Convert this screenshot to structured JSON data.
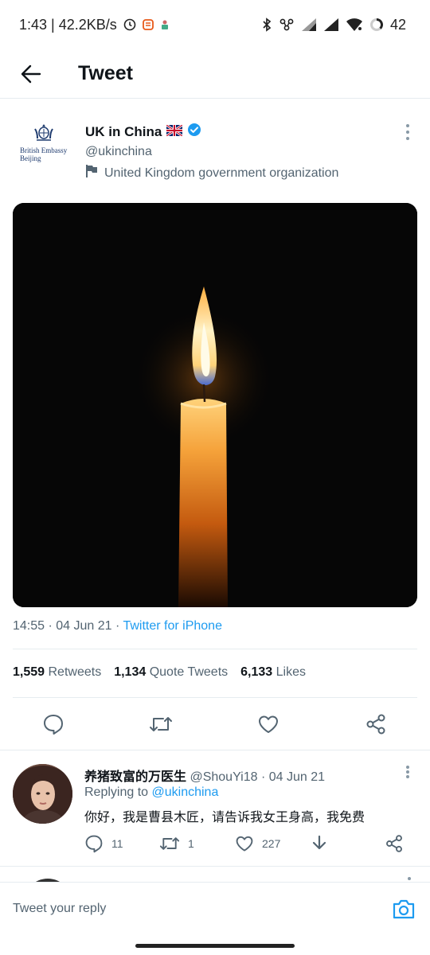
{
  "status_bar": {
    "time_speed": "1:43 | 42.2KB/s",
    "battery": "42"
  },
  "app_bar": {
    "title": "Tweet"
  },
  "tweet": {
    "author_name": "UK in China",
    "author_flag": "🇬🇧",
    "handle": "@ukinchina",
    "label": "United Kingdom government organization",
    "crest_text": "British Embassy\nBeijing",
    "timestamp": "14:55 · 04 Jun 21 · ",
    "source": "Twitter for iPhone",
    "stats": {
      "retweets_count": "1,559",
      "retweets_label": "Retweets",
      "quotes_count": "1,134",
      "quotes_label": "Quote Tweets",
      "likes_count": "6,133",
      "likes_label": "Likes"
    }
  },
  "reply": {
    "name": "养猪致富的万医生",
    "handle_date": " @ShouYi18 · 04 Jun 21",
    "replying_prefix": "Replying to ",
    "replying_to": "@ukinchina",
    "text": "你好，我是曹县木匠，请告诉我女王身高，我免费",
    "reply_count": "11",
    "retweet_count": "1",
    "like_count": "227"
  },
  "composer": {
    "placeholder": "Tweet your reply"
  },
  "colors": {
    "accent": "#1d9bf0",
    "secondary_text": "#536471",
    "divider": "#e6ecf0"
  },
  "icons": [
    "back-arrow-icon",
    "verified-badge-icon",
    "flag-icon",
    "more-icon",
    "reply-icon",
    "retweet-icon",
    "like-icon",
    "share-icon",
    "download-icon",
    "camera-icon"
  ]
}
